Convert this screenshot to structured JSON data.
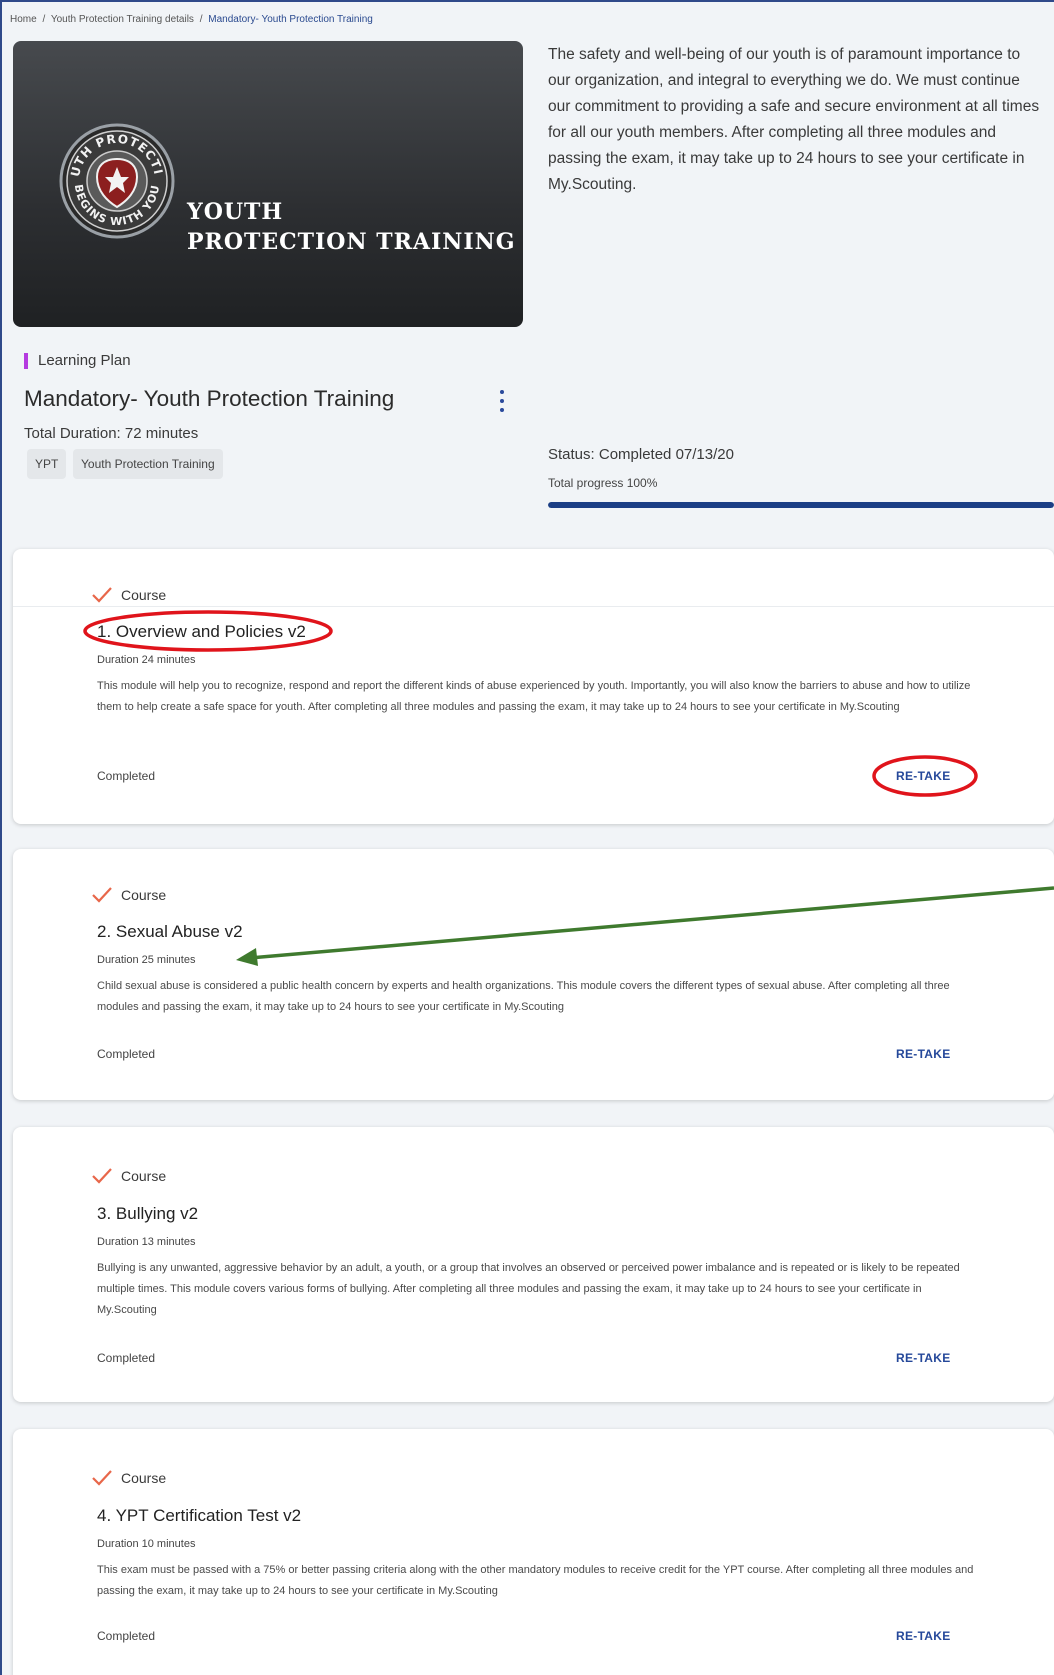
{
  "breadcrumb": {
    "home": "Home",
    "details": "Youth Protection Training details",
    "current": "Mandatory- Youth Protection Training",
    "separator": "/"
  },
  "hero": {
    "title_line1": "YOUTH",
    "title_line2": "PROTECTION TRAINING",
    "badge_text_top": "YOUTH PROTECTION",
    "badge_text_bottom": "BEGINS WITH YOU"
  },
  "intro_text": "The safety and well-being of our youth is of paramount importance to our organization, and integral to everything we do. We must continue our commitment to providing a safe and secure environment at all times for all our youth members. After completing all three modules and passing the exam, it may take up to 24 hours to see your certificate in My.Scouting.",
  "plan": {
    "tag": "Learning Plan",
    "title": "Mandatory- Youth Protection Training",
    "total_duration": "Total Duration: 72 minutes",
    "chips": [
      "YPT",
      "Youth Protection Training"
    ],
    "status": "Status: Completed 07/13/20",
    "progress_label": "Total progress 100%",
    "progress_value": 1.0,
    "accent_color": "#b53be0",
    "progress_color": "#1b3e85"
  },
  "courses": [
    {
      "type_label": "Course",
      "title": "1. Overview and Policies v2",
      "duration": "Duration 24 minutes",
      "description": "This module will help you to recognize, respond and report the different kinds of abuse experienced by youth. Importantly, you will also know the barriers to abuse and how to utilize them to help create a safe space for youth. After completing all three modules and passing the exam, it may take up to 24 hours to see your certificate in My.Scouting",
      "status": "Completed",
      "action": "RE-TAKE"
    },
    {
      "type_label": "Course",
      "title": "2. Sexual Abuse v2",
      "duration": "Duration 25 minutes",
      "description": "Child sexual abuse is considered a public health concern by experts and health organizations. This module covers the different types of sexual abuse. After completing all three modules and passing the exam, it may take up to 24 hours to see your certificate in My.Scouting",
      "status": "Completed",
      "action": "RE-TAKE"
    },
    {
      "type_label": "Course",
      "title": "3. Bullying v2",
      "duration": "Duration 13 minutes",
      "description": "Bullying is any unwanted, aggressive behavior by an adult, a youth, or a group that involves an observed or perceived power imbalance and is repeated or is likely to be repeated multiple times. This module covers various forms of bullying. After completing all three modules and passing the exam, it may take up to 24 hours to see your certificate in My.Scouting",
      "status": "Completed",
      "action": "RE-TAKE"
    },
    {
      "type_label": "Course",
      "title": "4. YPT Certification Test v2",
      "duration": "Duration 10 minutes",
      "description": "This exam must be passed with a 75% or better passing criteria along with the other mandatory modules to receive credit for the YPT course. After completing all three modules and passing the exam, it may take up to 24 hours to see your certificate in My.Scouting",
      "status": "Completed",
      "action": "RE-TAKE"
    }
  ],
  "colors": {
    "check": "#e8674a",
    "link": "#25489a",
    "annotation_red": "#e0141b",
    "annotation_green": "#3f7a2e"
  }
}
